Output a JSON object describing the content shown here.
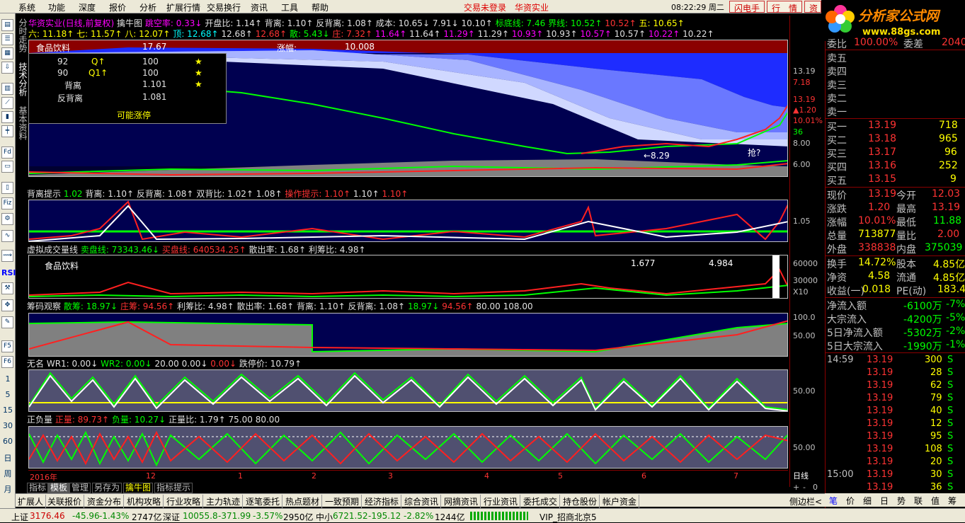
{
  "menu": {
    "items": [
      "系统",
      "功能",
      "深度",
      "报价",
      "分析",
      "扩展行情",
      "交易换行",
      "资讯",
      "工具",
      "帮助"
    ],
    "trade_status": "交易未登录",
    "stock_name": "华资实业",
    "time": "08:22:29 周二",
    "btns": [
      "闪电手",
      "行　情",
      "资"
    ]
  },
  "logo": {
    "title": "分析家公式网",
    "url": "www.88gs.com"
  },
  "lefttool": {
    "labels": [
      "Fd",
      "Fiz",
      "RSI",
      "F5",
      "F6",
      "1",
      "5",
      "15",
      "30",
      "60",
      "日",
      "周",
      "月"
    ]
  },
  "vtabs": [
    "分时走势",
    "技术分析",
    "基本资料"
  ],
  "main_header": {
    "line1": [
      "华资实业(日线,前复权)",
      "擒牛图",
      "跳空率: 0.33↓",
      "开盘比: 1.14↑",
      "背离: 1.10↑",
      "反背离: 1.08↑",
      "成本: 10.65↓",
      "7.91↓",
      "10.10↑",
      "标底线: 7.46",
      "界线: 10.52↑",
      "10.52↑",
      "五: 10.65↑"
    ],
    "line2": [
      "六: 11.18↑",
      "七: 11.57↑",
      "八: 12.07↑",
      "顶: 12.68↑",
      "12.68↑",
      "12.68↑",
      "散: 5.43↓",
      "庄: 7.32↑",
      "11.64↑",
      "11.64↑",
      "11.29↑",
      "11.29↑",
      "10.93↑",
      "10.93↑",
      "10.57↑",
      "10.57↑",
      "10.22↑",
      "10.22↑"
    ]
  },
  "chart_label": {
    "sector": "食品饮料",
    "up": "涨幅:",
    "up_val": "10.008",
    "peak": "17.67",
    "low": "←8.29",
    "note": "抢?"
  },
  "infobox": {
    "rows": [
      [
        "92",
        "Q↑",
        "100",
        "★"
      ],
      [
        "90",
        "Q1↑",
        "100",
        "★"
      ],
      [
        "背离",
        "",
        "1.101",
        "★"
      ],
      [
        "反背离",
        "",
        "1.081",
        ""
      ]
    ],
    "footer": "可能涨停"
  },
  "panel2_header": [
    "背离提示",
    "1.02",
    "背离: 1.10↑",
    "反背离: 1.08↑",
    "双背比: 1.02↑",
    "1.08↑",
    "操作提示: 1.10↑",
    "1.10↑",
    "1.10↑"
  ],
  "panel3_header": [
    "虚拟成交量线",
    "卖盘线: 73343.46↓",
    "买盘线: 640534.25↑",
    "散出率: 1.68↑",
    "利筹比: 4.98↑"
  ],
  "panel3_text": {
    "sector": "食品饮料",
    "v1": "1.677",
    "v2": "4.984"
  },
  "panel4_header": [
    "筹码观察",
    "散筹: 18.97↓",
    "庄筹: 94.56↑",
    "利筹比: 4.98↑",
    "散出率: 1.68↑",
    "背离: 1.10↑",
    "反背离: 1.08↑",
    "18.97↓",
    "94.56↑",
    "80.00",
    "108.00"
  ],
  "panel5_header": [
    "无名",
    "WR1: 0.00↓",
    "WR2: 0.00↓",
    "20.00",
    "0.00↓",
    "0.00↓",
    "跌停价: 10.79↑"
  ],
  "panel6_header": [
    "正负量",
    "正量: 89.73↑",
    "负量: 10.27↓",
    "正量比: 1.79↑",
    "75.00",
    "80.00"
  ],
  "x_axis": [
    "2016年",
    "12",
    "1",
    "2",
    "3",
    "4",
    "5",
    "6",
    "7"
  ],
  "axis_right": {
    "main": [
      "13.19",
      "7.18",
      "13.19",
      "▲1.20",
      "10.01%",
      "36",
      "8.00",
      "6.00"
    ],
    "p2": [
      "1.05"
    ],
    "p3": [
      "60000",
      "30000",
      "X10"
    ],
    "p4": [
      "100.0",
      "50.00"
    ],
    "p5": [
      "50.00"
    ],
    "p6": [
      "50.00"
    ],
    "period": "日线",
    "zoom": [
      "+",
      "-",
      "0"
    ]
  },
  "quote": {
    "top": [
      "委比",
      "100.00%",
      "委差",
      "2040"
    ],
    "sell": [
      [
        "卖五",
        "",
        ""
      ],
      [
        "卖四",
        "",
        ""
      ],
      [
        "卖三",
        "",
        ""
      ],
      [
        "卖二",
        "",
        ""
      ],
      [
        "卖一",
        "",
        ""
      ]
    ],
    "buy": [
      [
        "买一",
        "13.19",
        "718"
      ],
      [
        "买二",
        "13.18",
        "965"
      ],
      [
        "买三",
        "13.17",
        "96"
      ],
      [
        "买四",
        "13.16",
        "252"
      ],
      [
        "买五",
        "13.15",
        "9"
      ]
    ],
    "stats": [
      [
        "现价",
        "13.19",
        "今开",
        "12.03"
      ],
      [
        "涨跌",
        "1.20",
        "最高",
        "13.19"
      ],
      [
        "涨幅",
        "10.01%",
        "最低",
        "11.88"
      ],
      [
        "总量",
        "713877",
        "量比",
        "2.00"
      ],
      [
        "外盘",
        "338838",
        "内盘",
        "375039"
      ],
      [
        "换手",
        "14.72%",
        "股本",
        "4.85亿"
      ],
      [
        "净资",
        "4.58",
        "流通",
        "4.85亿"
      ],
      [
        "收益(一)",
        "0.018",
        "PE(动)",
        "183.4"
      ]
    ],
    "flow": [
      [
        "净流入额",
        "-6100万",
        "-7%"
      ],
      [
        "大宗流入",
        "-4200万",
        "-5%"
      ],
      [
        "5日净流入额",
        "-5302万",
        "-2%"
      ],
      [
        "5日大宗流入",
        "-1990万",
        "-1%"
      ]
    ],
    "ticks": [
      [
        "14:59",
        "13.19",
        "300",
        "S"
      ],
      [
        "",
        "13.19",
        "28",
        "S"
      ],
      [
        "",
        "13.19",
        "62",
        "S"
      ],
      [
        "",
        "13.19",
        "79",
        "S"
      ],
      [
        "",
        "13.19",
        "40",
        "S"
      ],
      [
        "",
        "13.19",
        "12",
        "S"
      ],
      [
        "",
        "13.19",
        "95",
        "S"
      ],
      [
        "",
        "13.19",
        "108",
        "S"
      ],
      [
        "",
        "13.19",
        "20",
        "S"
      ],
      [
        "15:00",
        "13.19",
        "30",
        "S"
      ],
      [
        "",
        "13.19",
        "36",
        "S"
      ]
    ]
  },
  "botbar1": [
    "指标",
    "模板",
    "管理",
    "另存为",
    "擒牛图",
    "指标提示"
  ],
  "tabbar": [
    "扩展人",
    "关联报价",
    "资金分布",
    "机构攻略",
    "行业攻略",
    "主力轨迹",
    "逐笔委托",
    "热点题材",
    "一致预期",
    "经济指标",
    "综合资讯",
    "网摘资讯",
    "行业资讯",
    "委托成交",
    "持仓股份",
    "帐户资金"
  ],
  "tabbar_right": "侧边栏<",
  "rtabs": [
    "笔",
    "价",
    "细",
    "日",
    "势",
    "联",
    "值",
    "筹"
  ],
  "status": {
    "sh": "上证",
    "sh_v": "3176.46",
    "sh_c": "-45.96",
    "sh_p": "-1.43%",
    "sh_a": "2747亿",
    "sz": "深证",
    "sz_v": "10055.8",
    "sz_c": "-371.99",
    "sz_p": "-3.57%",
    "sz_a": "2950亿",
    "zx": "中小",
    "zx_v": "6721.52",
    "zx_c": "-195.12",
    "zx_p": "-2.82%",
    "zx_a": "1244亿",
    "vip": "VIP_招商北京5"
  },
  "colors": {
    "up": "#ff3333",
    "down": "#00ff00",
    "panel_bg": "#000040",
    "axis": "#8a0000"
  }
}
